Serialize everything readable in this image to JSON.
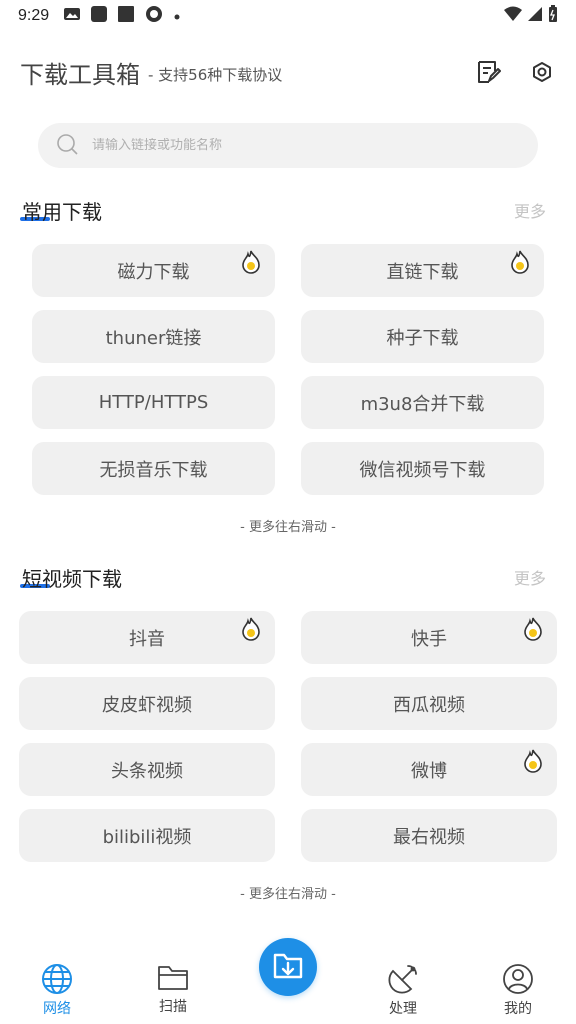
{
  "status_bar": {
    "time": "9:29"
  },
  "header": {
    "title": "下载工具箱",
    "subtitle": "- 支持56种下载协议"
  },
  "search": {
    "placeholder": "请输入链接或功能名称"
  },
  "sections": [
    {
      "title": "常用下载",
      "more": "更多",
      "hint": "- 更多往右滑动 -",
      "items": [
        {
          "label": "磁力下载",
          "hot": true
        },
        {
          "label": "直链下载",
          "hot": true
        },
        {
          "label": "thuner链接",
          "hot": false
        },
        {
          "label": "种子下载",
          "hot": false
        },
        {
          "label": "HTTP/HTTPS",
          "hot": false
        },
        {
          "label": "m3u8合并下载",
          "hot": false
        },
        {
          "label": "无损音乐下载",
          "hot": false
        },
        {
          "label": "微信视频号下载",
          "hot": false
        }
      ]
    },
    {
      "title": "短视频下载",
      "more": "更多",
      "hint": "- 更多往右滑动 -",
      "items": [
        {
          "label": "抖音",
          "hot": true
        },
        {
          "label": "快手",
          "hot": true
        },
        {
          "label": "皮皮虾视频",
          "hot": false
        },
        {
          "label": "西瓜视频",
          "hot": false
        },
        {
          "label": "头条视频",
          "hot": false
        },
        {
          "label": "微博",
          "hot": true
        },
        {
          "label": "bilibili视频",
          "hot": false
        },
        {
          "label": "最右视频",
          "hot": false
        }
      ]
    }
  ],
  "bottom_nav": {
    "items": [
      {
        "label": "网络",
        "icon": "globe-icon",
        "active": true
      },
      {
        "label": "扫描",
        "icon": "folder-icon",
        "active": false
      },
      {
        "label": "",
        "icon": "download-folder-icon",
        "active": false
      },
      {
        "label": "处理",
        "icon": "satellite-icon",
        "active": false
      },
      {
        "label": "我的",
        "icon": "user-icon",
        "active": false
      }
    ]
  },
  "colors": {
    "accent": "#1e8fe6",
    "underline": "#1e6fe6",
    "tile_bg": "#f0f0f0",
    "hot": "#f5c518"
  }
}
